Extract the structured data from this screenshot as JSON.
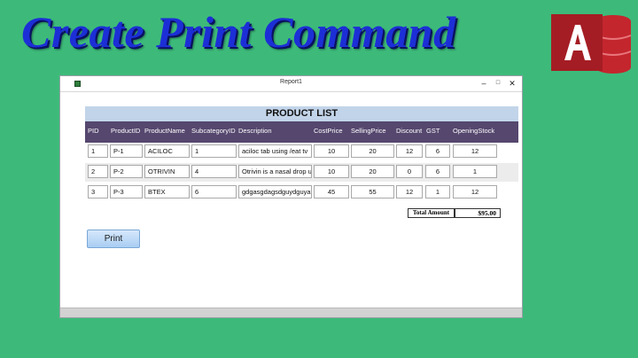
{
  "headline": "Create Print Command",
  "window": {
    "title": "Report1",
    "minimize": "–",
    "maximize": "□",
    "close": "✕"
  },
  "report": {
    "title": "PRODUCT LIST",
    "columns": [
      "PID",
      "ProductID",
      "ProductName",
      "SubcategoryID",
      "Description",
      "CostPrice",
      "SellingPrice",
      "Discount",
      "GST",
      "OpeningStock"
    ],
    "rows": [
      [
        "1",
        "P-1",
        "ACILOC",
        "1",
        "aciloc tab using /eat tv",
        "10",
        "20",
        "12",
        "6",
        "12"
      ],
      [
        "2",
        "P-2",
        "OTRIVIN",
        "4",
        "Otrivin is a nasal drop u",
        "10",
        "20",
        "0",
        "6",
        "1"
      ],
      [
        "3",
        "P-3",
        "BTEX",
        "6",
        "gdgasgdagsdguydguyagd",
        "45",
        "55",
        "12",
        "1",
        "12"
      ]
    ],
    "total_label": "Total Amount",
    "total_value": "$95.00",
    "print_label": "Print"
  },
  "colors": {
    "background": "#3dba7a",
    "headline": "#1c2fd6",
    "banner": "#c2d4e9",
    "header": "#55476e",
    "access_red": "#c4262e"
  },
  "icons": {
    "app": "report-icon",
    "logo": "microsoft-access-logo"
  }
}
